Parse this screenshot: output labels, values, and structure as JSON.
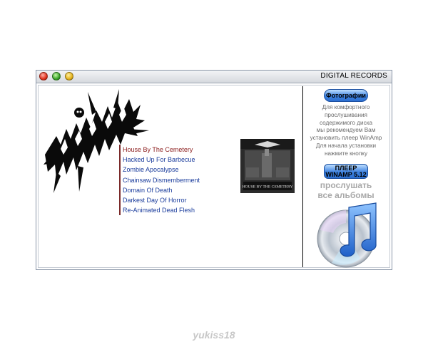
{
  "window": {
    "title": "DIGITAL RECORDS"
  },
  "tracks": [
    "House By The Cemetery",
    "Hacked Up For Barbecue",
    "Zombie Apocalypse",
    "Chainsaw Dismemberment",
    "Domain Of Death",
    "Darkest Day Of Horror",
    "Re-Animated Dead Flesh"
  ],
  "cover": {
    "caption": "HOUSE BY THE CEMETERY"
  },
  "sidebar": {
    "photos_button": "Фотографии",
    "info_lines": [
      "Для комфортного",
      "прослушивания",
      "содержимого диска",
      "мы рекомендуем Вам",
      "установить плеер WinAmp",
      "Для начала установки",
      "нажмите кнопку"
    ],
    "player_button_line1": "ПЛЕЕР",
    "player_button_line2": "WINAMP 5.12",
    "listen_line1": "прослушать",
    "listen_line2": "все альбомы"
  },
  "footer": {
    "signature": "yukiss18"
  },
  "colors": {
    "track_link": "#1a3c9c",
    "track_active": "#8a1a1a",
    "button_blue": "#3d82e0"
  }
}
